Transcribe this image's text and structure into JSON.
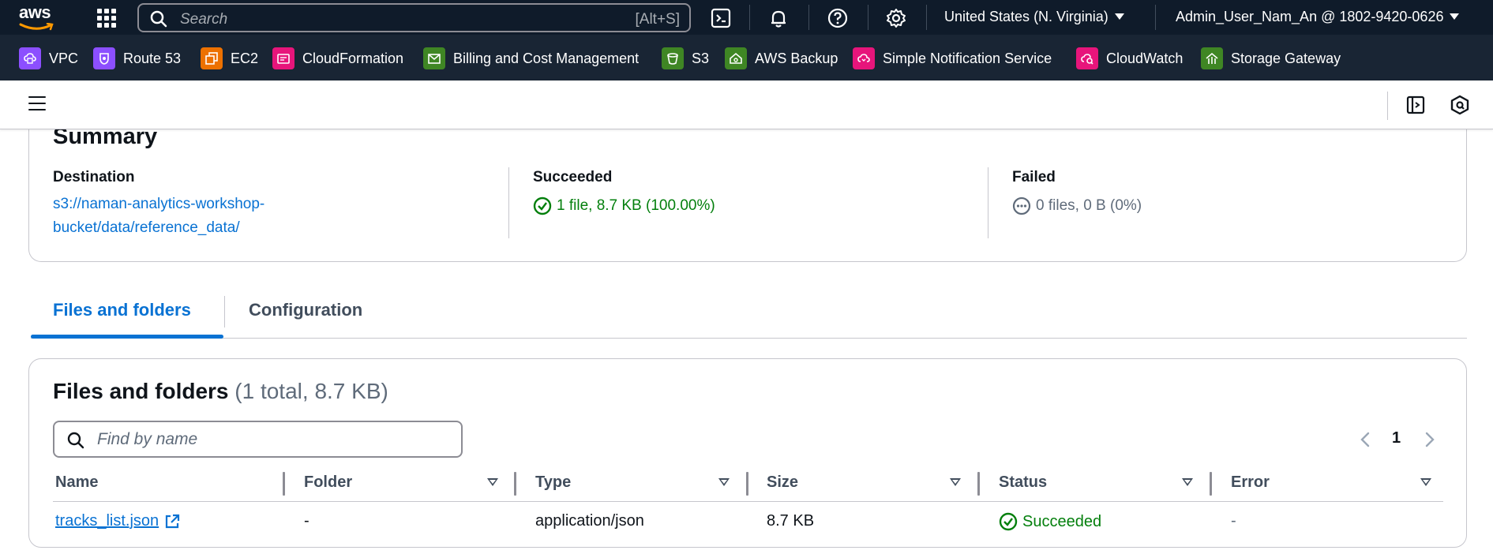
{
  "topnav": {
    "logo_text": "aws",
    "search_placeholder": "Search",
    "search_shortcut": "[Alt+S]",
    "region": "United States (N. Virginia)",
    "account": "Admin_User_Nam_An @ 1802-9420-0626",
    "icons": [
      "cloudshell-icon",
      "bell-icon",
      "help-icon",
      "settings-icon"
    ]
  },
  "favorites": [
    {
      "label": "VPC",
      "color": "#8c4fff"
    },
    {
      "label": "Route 53",
      "color": "#8c4fff"
    },
    {
      "label": "EC2",
      "color": "#ed7100"
    },
    {
      "label": "CloudFormation",
      "color": "#e7157b"
    },
    {
      "label": "Billing and Cost Management",
      "color": "#3f8624"
    },
    {
      "label": "S3",
      "color": "#3f8624"
    },
    {
      "label": "AWS Backup",
      "color": "#3f8624"
    },
    {
      "label": "Simple Notification Service",
      "color": "#e7157b"
    },
    {
      "label": "CloudWatch",
      "color": "#e7157b"
    },
    {
      "label": "Storage Gateway",
      "color": "#3f8624"
    }
  ],
  "summary": {
    "title": "Summary",
    "destination_label": "Destination",
    "destination_value": "s3://naman-analytics-workshop-bucket/data/reference_data/",
    "succeeded_label": "Succeeded",
    "succeeded_value": "1 file, 8.7 KB (100.00%)",
    "failed_label": "Failed",
    "failed_value": "0 files, 0 B (0%)"
  },
  "tabs": [
    {
      "label": "Files and folders",
      "active": true
    },
    {
      "label": "Configuration",
      "active": false
    }
  ],
  "files": {
    "title": "Files and folders",
    "count": "(1 total, 8.7 KB)",
    "search_placeholder": "Find by name",
    "page": "1",
    "columns": [
      "Name",
      "Folder",
      "Type",
      "Size",
      "Status",
      "Error"
    ],
    "rows": [
      {
        "name": "tracks_list.json",
        "folder": "-",
        "type": "application/json",
        "size": "8.7 KB",
        "status": "Succeeded",
        "error": "-"
      }
    ]
  },
  "colors": {
    "nav_bg": "#0f1b2a",
    "fav_bg": "#192534",
    "link": "#0972d3",
    "success": "#037f0c",
    "muted": "#5f6b7a"
  }
}
